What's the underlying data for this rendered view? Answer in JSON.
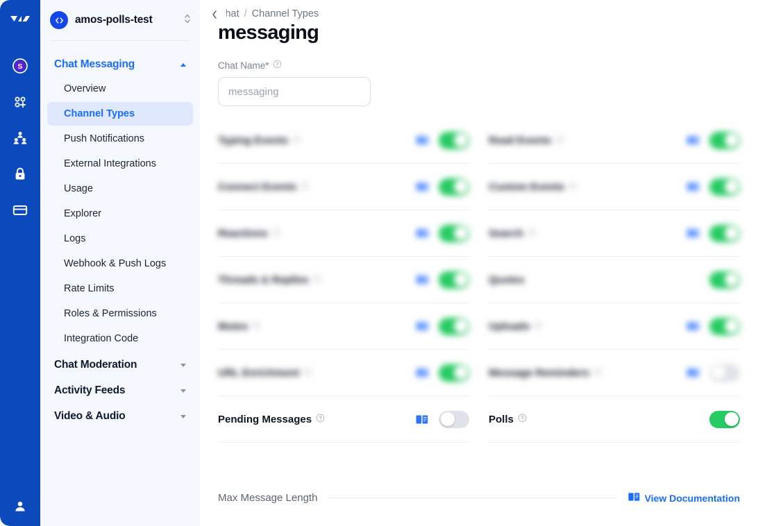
{
  "rail": {
    "logo_icon": "stream-logo-icon",
    "background": "#0b49bd",
    "items": [
      {
        "icon": "stream-badge-icon",
        "name": "stream-badge"
      },
      {
        "icon": "apps-add-icon",
        "name": "apps-add"
      },
      {
        "icon": "team-members-icon",
        "name": "team-members"
      },
      {
        "icon": "lock-icon",
        "name": "security"
      },
      {
        "icon": "credit-card-icon",
        "name": "billing"
      }
    ],
    "account_icon": "user-avatar-icon"
  },
  "sidebar": {
    "org": {
      "name": "amos-polls-test",
      "badge_icon": "code-brackets-icon",
      "badge_color": "#1347e8",
      "switcher_icon": "chevron-up-down-icon"
    },
    "groups": [
      {
        "label": "Chat Messaging",
        "expanded": true,
        "caret": "caret-up-icon",
        "items": [
          {
            "label": "Overview",
            "selected": false
          },
          {
            "label": "Channel Types",
            "selected": true
          },
          {
            "label": "Push Notifications",
            "selected": false
          },
          {
            "label": "External Integrations",
            "selected": false
          },
          {
            "label": "Usage",
            "selected": false
          },
          {
            "label": "Explorer",
            "selected": false
          },
          {
            "label": "Logs",
            "selected": false
          },
          {
            "label": "Webhook & Push Logs",
            "selected": false
          },
          {
            "label": "Rate Limits",
            "selected": false
          },
          {
            "label": "Roles & Permissions",
            "selected": false
          },
          {
            "label": "Integration Code",
            "selected": false
          }
        ]
      },
      {
        "label": "Chat Moderation",
        "expanded": false,
        "caret": "caret-down-icon",
        "items": []
      },
      {
        "label": "Activity Feeds",
        "expanded": false,
        "caret": "caret-down-icon",
        "items": []
      },
      {
        "label": "Video & Audio",
        "expanded": false,
        "caret": "caret-down-icon",
        "items": []
      }
    ]
  },
  "main": {
    "back_icon": "chevron-left-icon",
    "breadcrumb": {
      "root": "Chat",
      "separator": "/",
      "current": "Channel Types"
    },
    "title": "messaging",
    "chat_name": {
      "label": "Chat Name*",
      "help_icon": "help-circle-icon",
      "value": "messaging",
      "placeholder": "messaging"
    },
    "settings_left": [
      {
        "label": "Typing Events",
        "doc_icon": "docs-book-icon",
        "enabled": true,
        "blurred": true
      },
      {
        "label": "Connect Events",
        "doc_icon": "docs-book-icon",
        "enabled": true,
        "blurred": true
      },
      {
        "label": "Reactions",
        "doc_icon": "docs-book-icon",
        "enabled": true,
        "blurred": true
      },
      {
        "label": "Threads & Replies",
        "doc_icon": "docs-book-icon",
        "enabled": true,
        "blurred": true
      },
      {
        "label": "Mutes",
        "doc_icon": "docs-book-icon",
        "enabled": true,
        "blurred": true
      },
      {
        "label": "URL Enrichment",
        "doc_icon": "docs-book-icon",
        "enabled": true,
        "blurred": true
      }
    ],
    "settings_right": [
      {
        "label": "Read Events",
        "doc_icon": "docs-book-icon",
        "enabled": true,
        "blurred": true
      },
      {
        "label": "Custom Events",
        "doc_icon": "docs-book-icon",
        "enabled": true,
        "blurred": true
      },
      {
        "label": "Search",
        "doc_icon": "docs-book-icon",
        "enabled": true,
        "blurred": true
      },
      {
        "label": "Quotes",
        "doc_icon": "",
        "enabled": true,
        "blurred": true
      },
      {
        "label": "Uploads",
        "doc_icon": "docs-book-icon",
        "enabled": true,
        "blurred": true
      },
      {
        "label": "Message Reminders",
        "doc_icon": "docs-book-icon",
        "enabled": false,
        "blurred": true
      }
    ],
    "settings_sharp": [
      {
        "label": "Pending Messages",
        "help_icon": "help-circle-icon",
        "doc_icon": "docs-book-icon",
        "enabled": false
      },
      {
        "label": "Polls",
        "help_icon": "help-circle-icon",
        "doc_icon": "",
        "enabled": true
      }
    ],
    "footer": {
      "max_length_label": "Max Message Length",
      "doc_link_label": "View Documentation",
      "doc_link_icon": "docs-book-icon"
    }
  },
  "colors": {
    "rail_blue": "#0b49bd",
    "accent_blue": "#1a6cff",
    "toggle_on_green": "#26cb62",
    "toggle_off_grey": "#dfe3e9",
    "sidebar_bg": "#f5f8ff",
    "selected_bg": "#dfe8fd"
  }
}
